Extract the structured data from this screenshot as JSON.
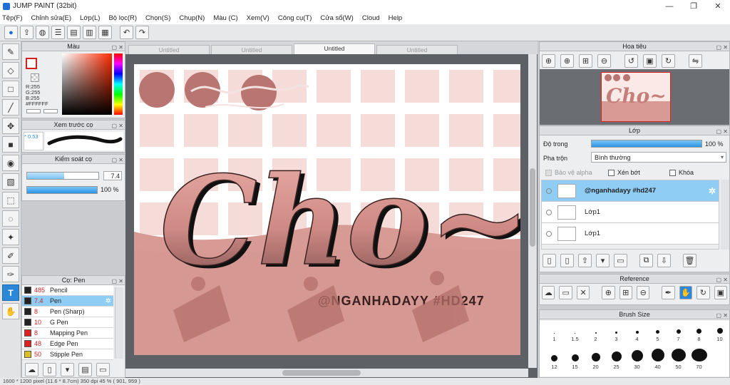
{
  "window": {
    "title": "JUMP PAINT (32bit)",
    "minimize": "—",
    "maximize": "❐",
    "close": "✕"
  },
  "menu": [
    "Tệp(F)",
    "Chỉnh sửa(E)",
    "Lớp(L)",
    "Bộ lọc(R)",
    "Chọn(S)",
    "Chụp(N)",
    "Màu (C)",
    "Xem(V)",
    "Công cụ(T)",
    "Cửa sổ(W)",
    "Cloud",
    "Help"
  ],
  "doc_tabs": [
    {
      "label": "Untitled",
      "active": false
    },
    {
      "label": "Untitled",
      "active": false
    },
    {
      "label": "Untitled",
      "active": true
    },
    {
      "label": "Untitled",
      "active": false
    }
  ],
  "color_panel": {
    "title": "Màu",
    "r": "R:255",
    "g": "G:255",
    "b": "B:255",
    "hex": "#FFFFFF"
  },
  "brush_preview": {
    "title": "Xem trước cọ",
    "size": "* 0.53"
  },
  "control_panel": {
    "title": "Kiểm soát cọ",
    "size_value": "7.4",
    "size_fill": 0.52,
    "opacity_value": "100 %",
    "opacity_fill": 1.0
  },
  "brush_list": {
    "title": "Cọ: Pen",
    "items": [
      {
        "size": "485",
        "name": "Pencil",
        "color": "#222222",
        "active": false
      },
      {
        "size": "7.4",
        "name": "Pen",
        "color": "#222222",
        "active": true
      },
      {
        "size": "8",
        "name": "Pen (Sharp)",
        "color": "#222222",
        "active": false
      },
      {
        "size": "10",
        "name": "G Pen",
        "color": "#222222",
        "active": false
      },
      {
        "size": "8",
        "name": "Mapping Pen",
        "color": "#e02020",
        "active": false
      },
      {
        "size": "48",
        "name": "Edge Pen",
        "color": "#e02020",
        "active": false
      },
      {
        "size": "50",
        "name": "Stipple Pen",
        "color": "#d8c020",
        "active": false
      }
    ]
  },
  "navigator": {
    "title": "Hoa tiêu"
  },
  "layers": {
    "title": "Lớp",
    "opacity_label": "Độ trong",
    "opacity_value": "100 %",
    "blend_label": "Pha trộn",
    "blend_value": "Bình thường",
    "protect_alpha": "Bảo vệ alpha",
    "clipping": "Xén bớt",
    "lock": "Khóa",
    "rows": [
      {
        "name": "@nganhadayy #hd247",
        "active": true
      },
      {
        "name": "Lớp1",
        "active": false
      },
      {
        "name": "Lớp1",
        "active": false
      }
    ]
  },
  "reference": {
    "title": "Reference"
  },
  "brush_size": {
    "title": "Brush Size",
    "sizes": [
      "1",
      "1.5",
      "2",
      "3",
      "4",
      "5",
      "7",
      "8",
      "10",
      "12",
      "15",
      "20",
      "25",
      "30",
      "40",
      "50",
      "70"
    ]
  },
  "canvas_art": {
    "main_text": "Cho~",
    "watermark": "@NGANHADAYY #HD247"
  },
  "status": "1600 * 1200 pixel  (11.6 * 8.7cm)  350 dpi  45 %  ( 901, 959 )"
}
